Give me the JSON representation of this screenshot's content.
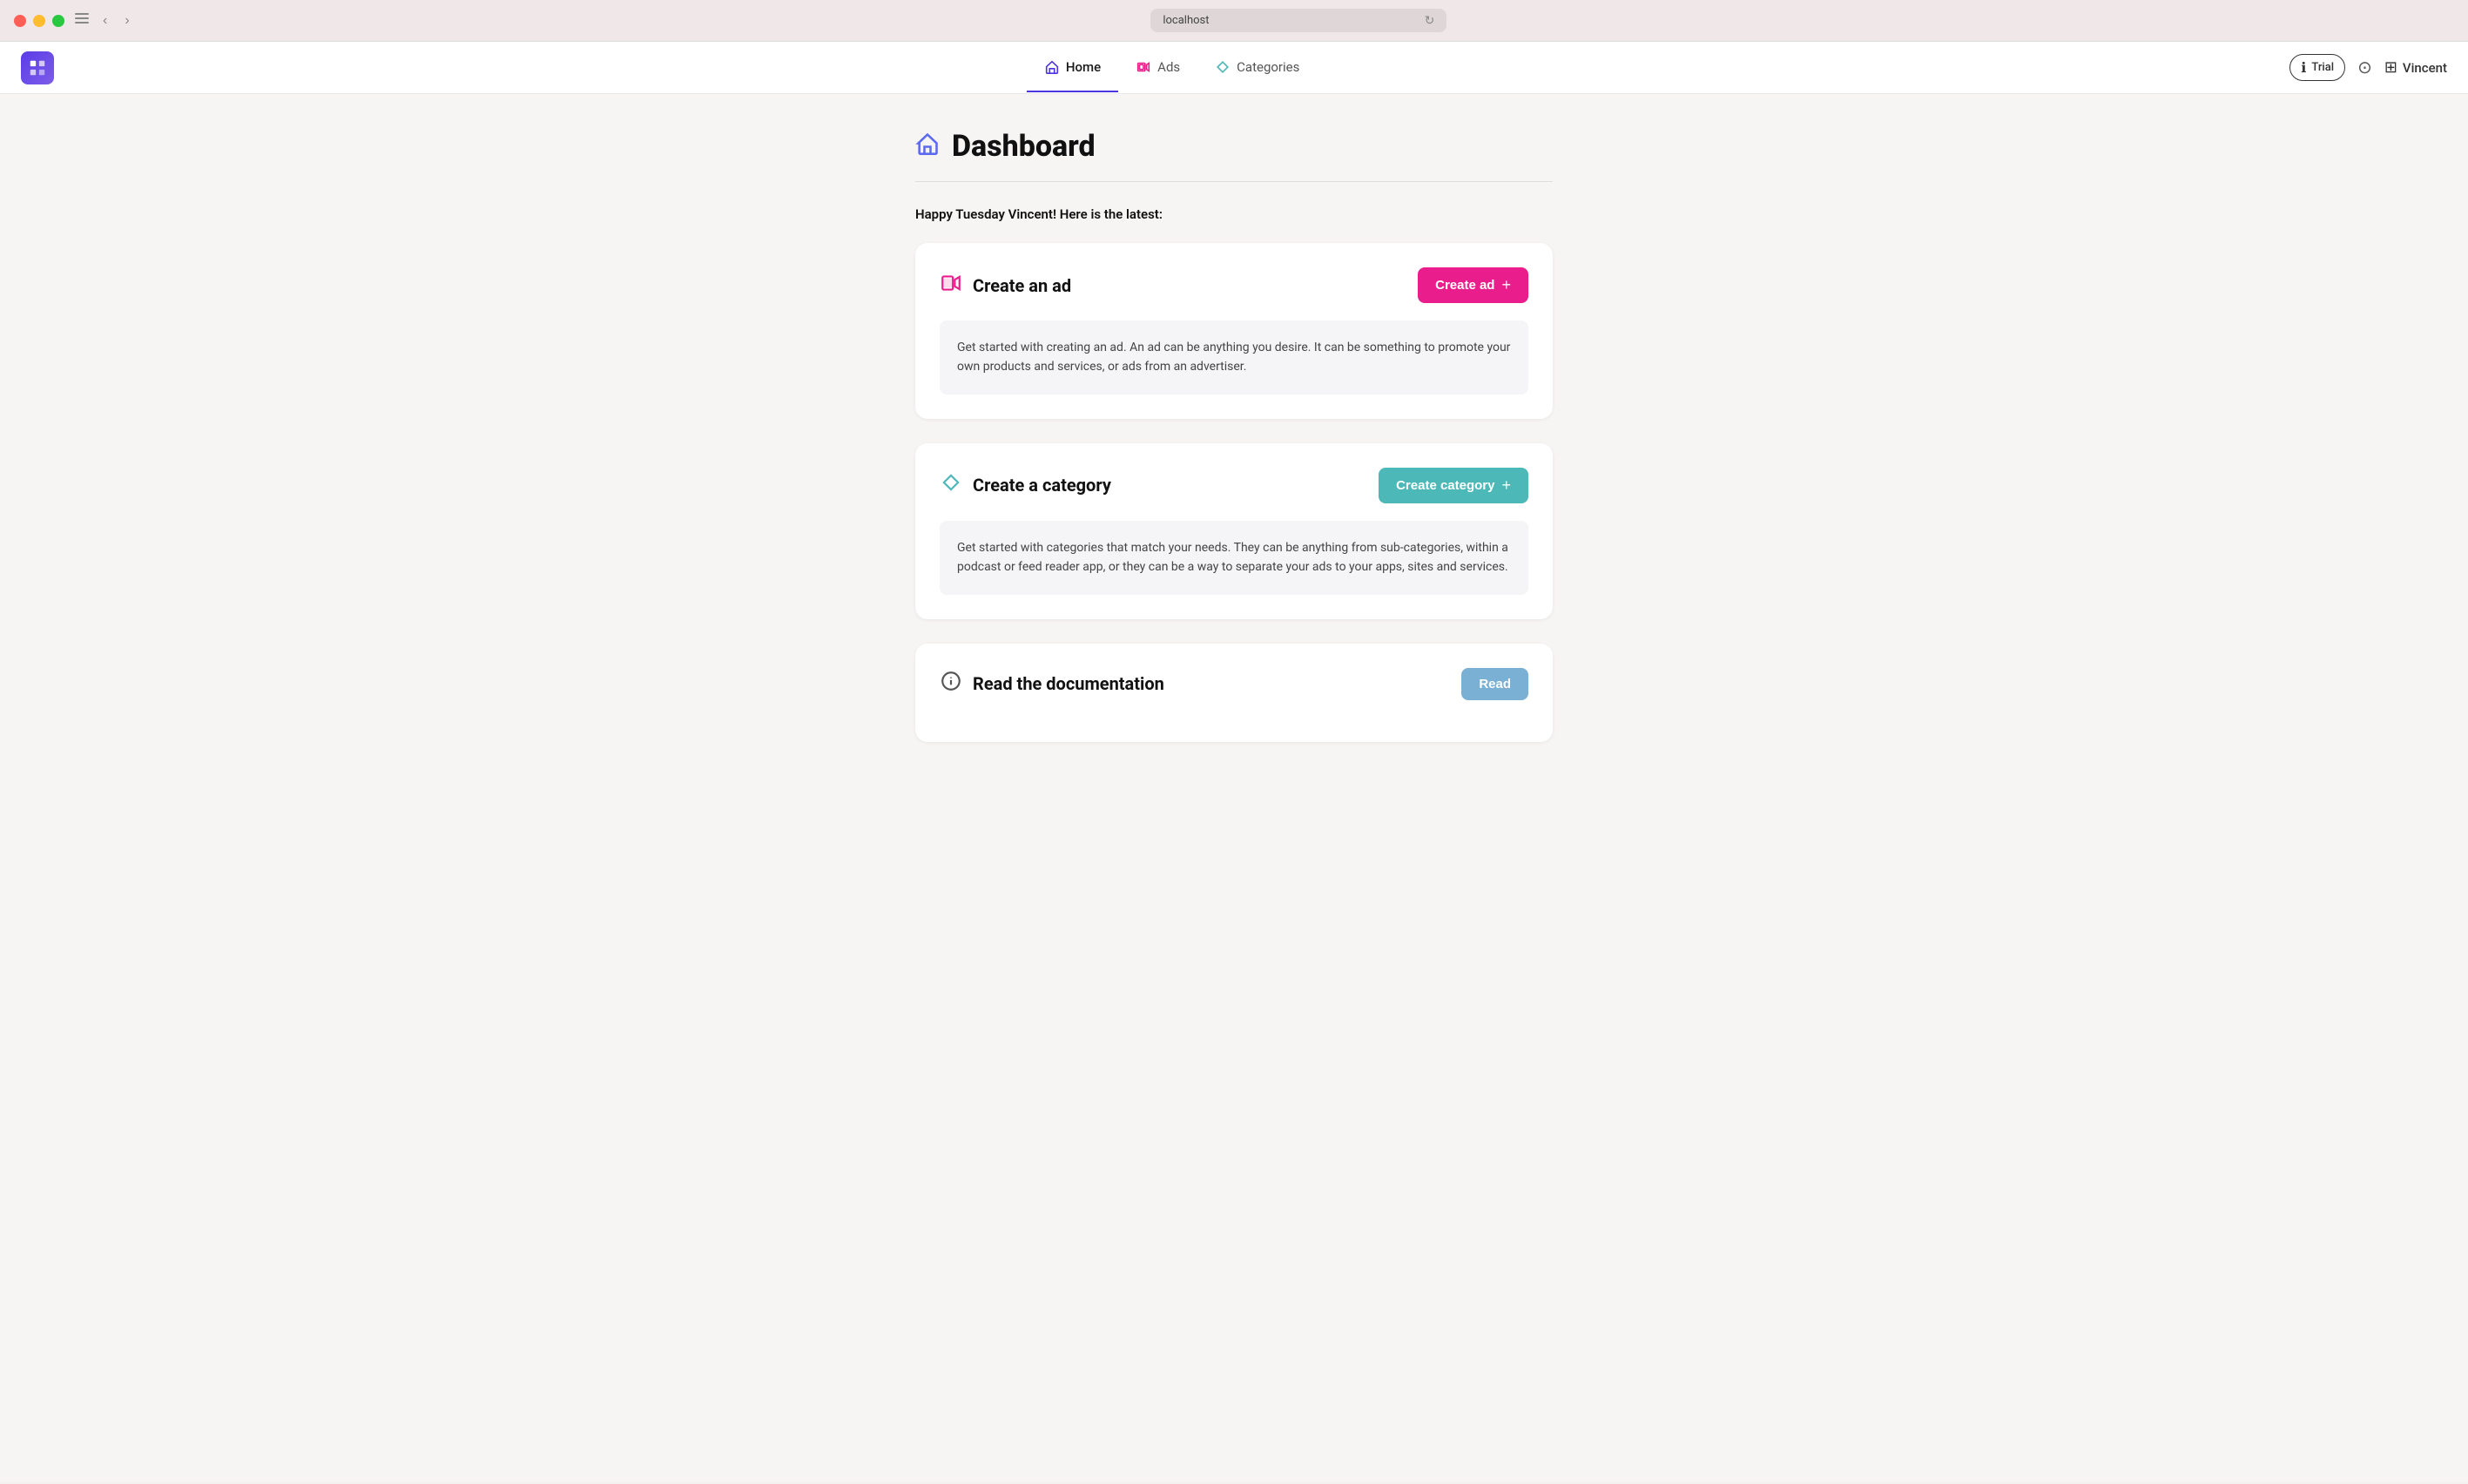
{
  "browser": {
    "url": "localhost",
    "refresh_label": "↻"
  },
  "navbar": {
    "logo_label": "App Logo",
    "nav_items": [
      {
        "id": "home",
        "label": "Home",
        "active": true
      },
      {
        "id": "ads",
        "label": "Ads",
        "active": false
      },
      {
        "id": "categories",
        "label": "Categories",
        "active": false
      }
    ],
    "trial_label": "Trial",
    "help_label": "?",
    "user_label": "Vincent"
  },
  "page": {
    "title": "Dashboard",
    "greeting": "Happy Tuesday Vincent! Here is the latest:"
  },
  "cards": [
    {
      "id": "create-ad",
      "title": "Create an ad",
      "button_label": "Create ad",
      "description": "Get started with creating an ad. An ad can be anything you desire. It can be something to promote your own products and services, or ads from an advertiser."
    },
    {
      "id": "create-category",
      "title": "Create a category",
      "button_label": "Create category",
      "description": "Get started with categories that match your needs. They can be anything from sub-categories, within a podcast or feed reader app, or they can be a way to separate your ads to your apps, sites and services."
    },
    {
      "id": "read-docs",
      "title": "Read the documentation",
      "button_label": "Read",
      "description": ""
    }
  ]
}
